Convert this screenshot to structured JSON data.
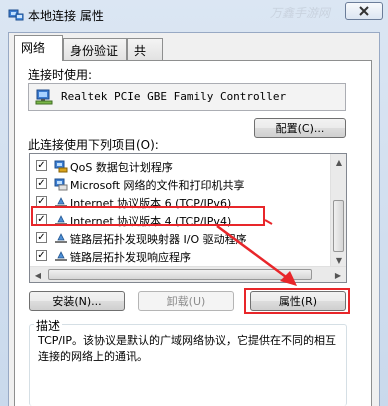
{
  "window": {
    "title": "本地连接 属性",
    "close_icon": "close-icon"
  },
  "tabs": [
    {
      "label": "网络",
      "active": true
    },
    {
      "label": "身份验证",
      "active": false
    },
    {
      "label": "共享",
      "active": false
    }
  ],
  "connect_using": {
    "label": "连接时使用:",
    "adapter_name": "Realtek PCIe GBE Family Controller",
    "configure_label": "配置(C)..."
  },
  "items_section": {
    "label": "此连接使用下列项目(O):",
    "items": [
      {
        "label": "QoS 数据包计划程序",
        "checked": true,
        "icon": "qos-icon"
      },
      {
        "label": "Microsoft 网络的文件和打印机共享",
        "checked": true,
        "icon": "network-share-icon"
      },
      {
        "label": "Internet 协议版本 6 (TCP/IPv6)",
        "checked": true,
        "icon": "protocol-icon"
      },
      {
        "label": "Internet 协议版本 4 (TCP/IPv4)",
        "checked": true,
        "icon": "protocol-icon",
        "highlighted": true
      },
      {
        "label": "链路层拓扑发现映射器 I/O 驱动程序",
        "checked": true,
        "icon": "protocol-icon"
      },
      {
        "label": "链路层拓扑发现响应程序",
        "checked": true,
        "icon": "protocol-icon"
      }
    ]
  },
  "buttons": {
    "install": "安装(N)...",
    "uninstall": "卸载(U)",
    "properties": "属性(R)"
  },
  "description": {
    "title": "描述",
    "text": "TCP/IP。该协议是默认的广域网络协议，它提供在不同的相互连接的网络上的通讯。"
  },
  "watermark": "万鑫手游网",
  "colors": {
    "annotation_red": "#e8262a",
    "title_bg": "#dbe6f3"
  }
}
